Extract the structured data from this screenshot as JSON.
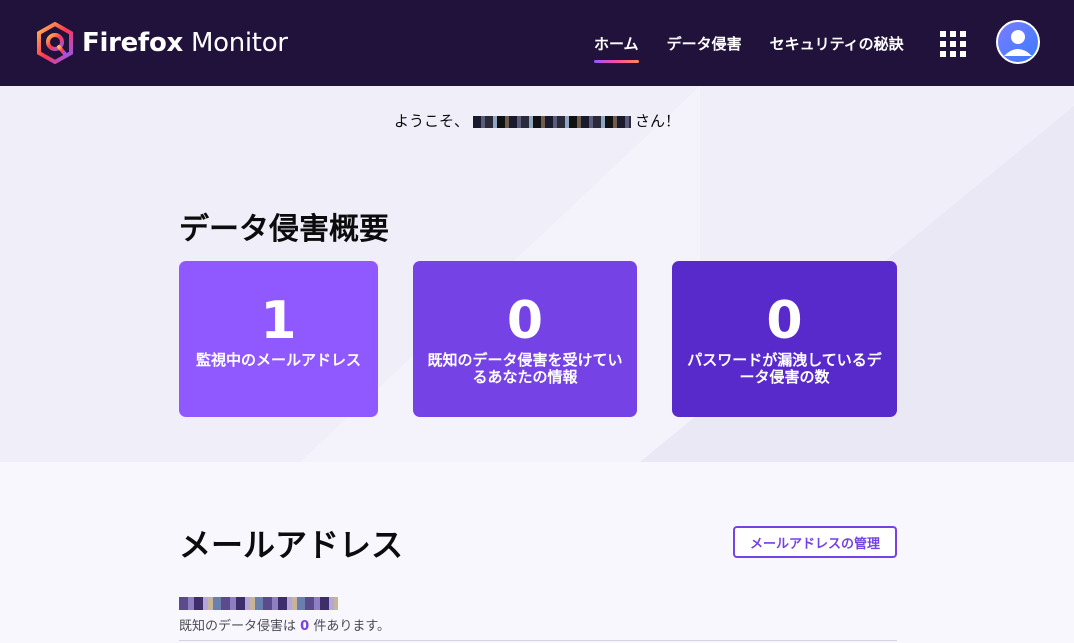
{
  "header": {
    "brand_bold": "Firefox",
    "brand_light": "Monitor",
    "nav": [
      {
        "label": "ホーム",
        "active": true
      },
      {
        "label": "データ侵害",
        "active": false
      },
      {
        "label": "セキュリティの秘訣",
        "active": false
      }
    ]
  },
  "hero": {
    "welcome_prefix": "ようこそ、",
    "welcome_suffix": "さん！",
    "overview_title": "データ侵害概要",
    "cards": [
      {
        "value": "1",
        "label": "監視中のメールアドレス"
      },
      {
        "value": "0",
        "label": "既知のデータ侵害を受けているあなたの情報"
      },
      {
        "value": "0",
        "label": "パスワードが漏洩しているデータ侵害の数"
      }
    ]
  },
  "emails": {
    "title": "メールアドレス",
    "manage_label": "メールアドレスの管理",
    "note_prefix": "既知のデータ侵害は",
    "note_count": "0",
    "note_suffix": "件あります。"
  },
  "colors": {
    "header_bg": "#20123a",
    "card1": "#9059ff",
    "card2": "#7542e5",
    "card3": "#592acb",
    "accent": "#7542e5"
  }
}
